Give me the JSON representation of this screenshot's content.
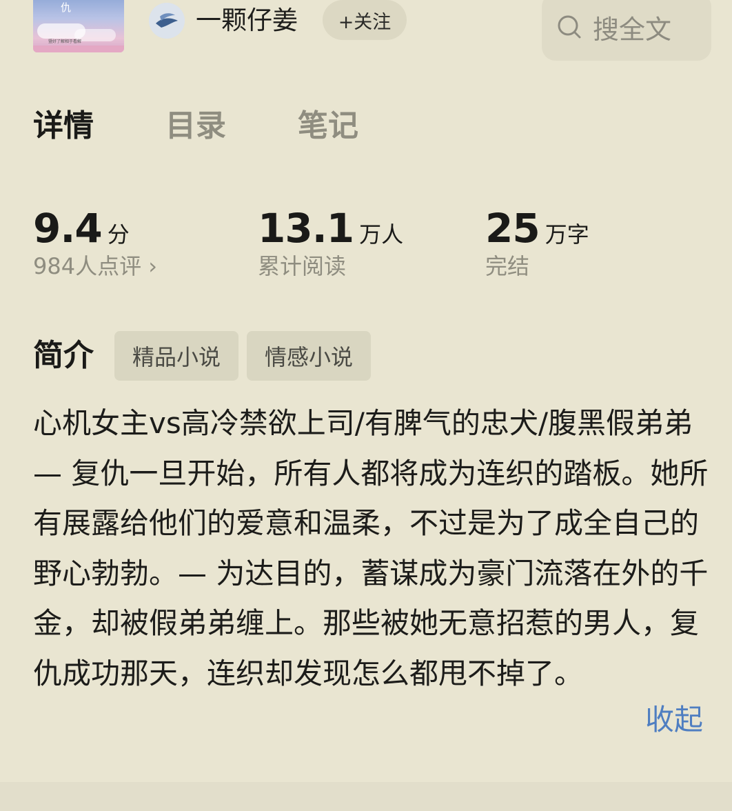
{
  "book": {
    "cover_title": "仇",
    "cover_caption": "暨好了解相于看解"
  },
  "author": {
    "name": "一颗仔姜",
    "follow_label": "+关注"
  },
  "search": {
    "label": "搜全文"
  },
  "tabs": [
    {
      "label": "详情",
      "active": true
    },
    {
      "label": "目录",
      "active": false
    },
    {
      "label": "笔记",
      "active": false
    }
  ],
  "stats": {
    "rating": {
      "value": "9.4",
      "unit": "分",
      "sub": "984人点评 ›"
    },
    "reads": {
      "value": "13.1",
      "unit": "万人",
      "sub": "累计阅读"
    },
    "words": {
      "value": "25",
      "unit": "万字",
      "sub": "完结"
    }
  },
  "intro": {
    "title": "简介",
    "tags": [
      "精品小说",
      "情感小说"
    ],
    "text": "心机女主vs高冷禁欲上司/有脾气的忠犬/腹黑假弟弟 — 复仇一旦开始，所有人都将成为连织的踏板。她所有展露给他们的爱意和温柔，不过是为了成全自己的野心勃勃。— 为达目的，蓄谋成为豪门流落在外的千金，却被假弟弟缠上。那些被她无意招惹的男人，复仇成功那天，连织却发现怎么都甩不掉了。",
    "collapse_label": "收起"
  },
  "colors": {
    "background": "#e9e5d1",
    "link": "#4f7ec1",
    "muted": "#8f8d80"
  }
}
